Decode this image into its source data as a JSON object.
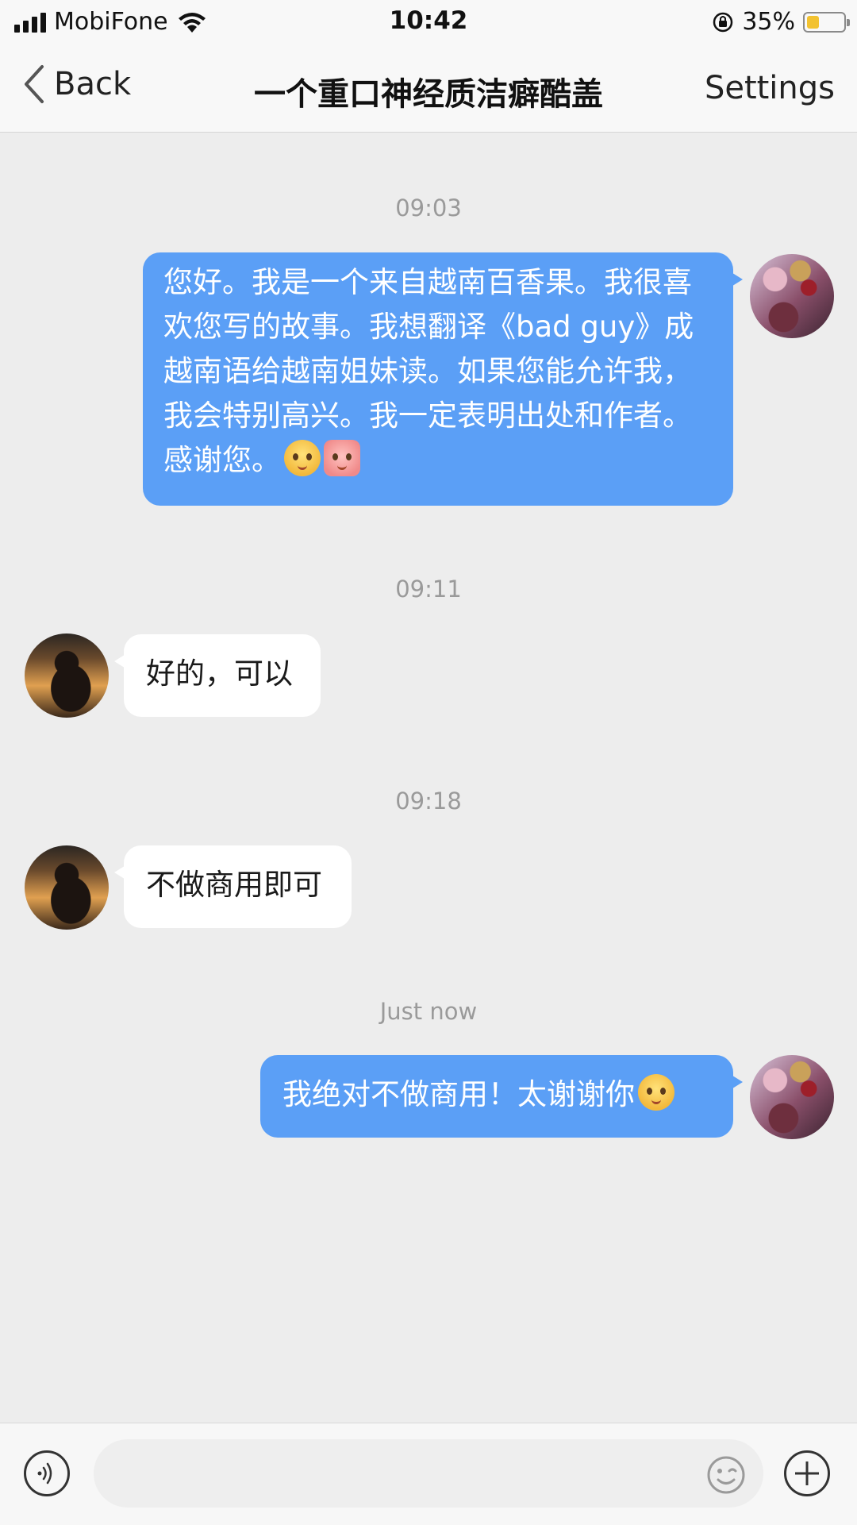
{
  "status_bar": {
    "carrier": "MobiFone",
    "time": "10:42",
    "battery_percent": "35%",
    "battery_level": 0.35,
    "icons": [
      "signal-icon",
      "wifi-icon",
      "orientation-lock-icon",
      "battery-icon"
    ]
  },
  "nav": {
    "back_label": "Back",
    "title": "一个重口神经质洁癖酷盖",
    "settings_label": "Settings"
  },
  "messages": [
    {
      "time": "09:03",
      "from": "me",
      "text": "您好。我是一个来自越南百香果。我很喜欢您写的故事。我想翻译《bad guy》成越南语给越南姐妹读。如果您能允许我，我会特别高兴。我一定表明出处和作者。感谢您。",
      "emojis": [
        "blushing-face-emoji",
        "pig-face-emoji"
      ]
    },
    {
      "time": "09:11",
      "from": "them",
      "text": "好的，可以"
    },
    {
      "time": "09:18",
      "from": "them",
      "text": "不做商用即可"
    },
    {
      "time": "Just now",
      "from": "me",
      "text": "我绝对不做商用！太谢谢你",
      "emojis": [
        "kiss-face-emoji"
      ]
    }
  ],
  "input": {
    "placeholder": "",
    "value": ""
  },
  "colors": {
    "my_bubble": "#5b9ff6",
    "their_bubble": "#ffffff",
    "background": "#ededed",
    "battery": "#f2c230"
  }
}
